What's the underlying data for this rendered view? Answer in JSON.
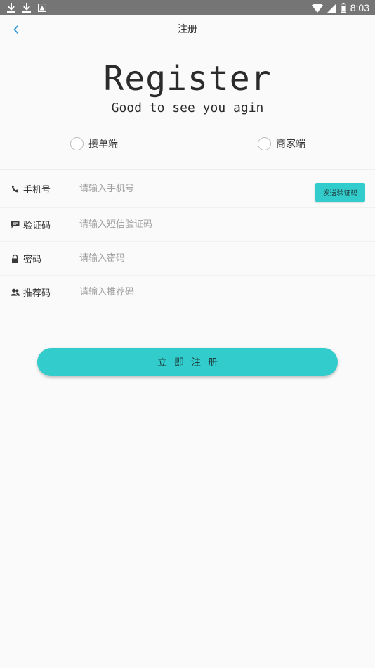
{
  "status_bar": {
    "time": "8:03",
    "left_icons": [
      "download-icon",
      "download-icon",
      "image-notification-icon"
    ],
    "right_icons": [
      "wifi-icon",
      "cell-signal-icon",
      "battery-icon"
    ]
  },
  "app_bar": {
    "title": "注册",
    "back_icon": "chevron-left-icon"
  },
  "hero": {
    "title": "Register",
    "subtitle": "Good to see you agin"
  },
  "role_options": [
    {
      "label": "接单端",
      "selected": false
    },
    {
      "label": "商家端",
      "selected": false
    }
  ],
  "form": {
    "phone": {
      "label": "手机号",
      "placeholder": "请输入手机号",
      "value": "",
      "icon": "phone-icon"
    },
    "send_code_label": "发送验证码",
    "code": {
      "label": "验证码",
      "placeholder": "请输入短信验证码",
      "value": "",
      "icon": "message-icon"
    },
    "password": {
      "label": "密码",
      "placeholder": "请输入密码",
      "value": "",
      "icon": "lock-icon"
    },
    "referral": {
      "label": "推荐码",
      "placeholder": "请输入推荐码",
      "value": "",
      "icon": "users-icon"
    }
  },
  "submit_label": "立即注册",
  "colors": {
    "accent": "#33cccc",
    "status_bar": "#757575",
    "back_icon": "#3a9ad9",
    "text": "#333333",
    "placeholder": "#9e9e9e"
  }
}
